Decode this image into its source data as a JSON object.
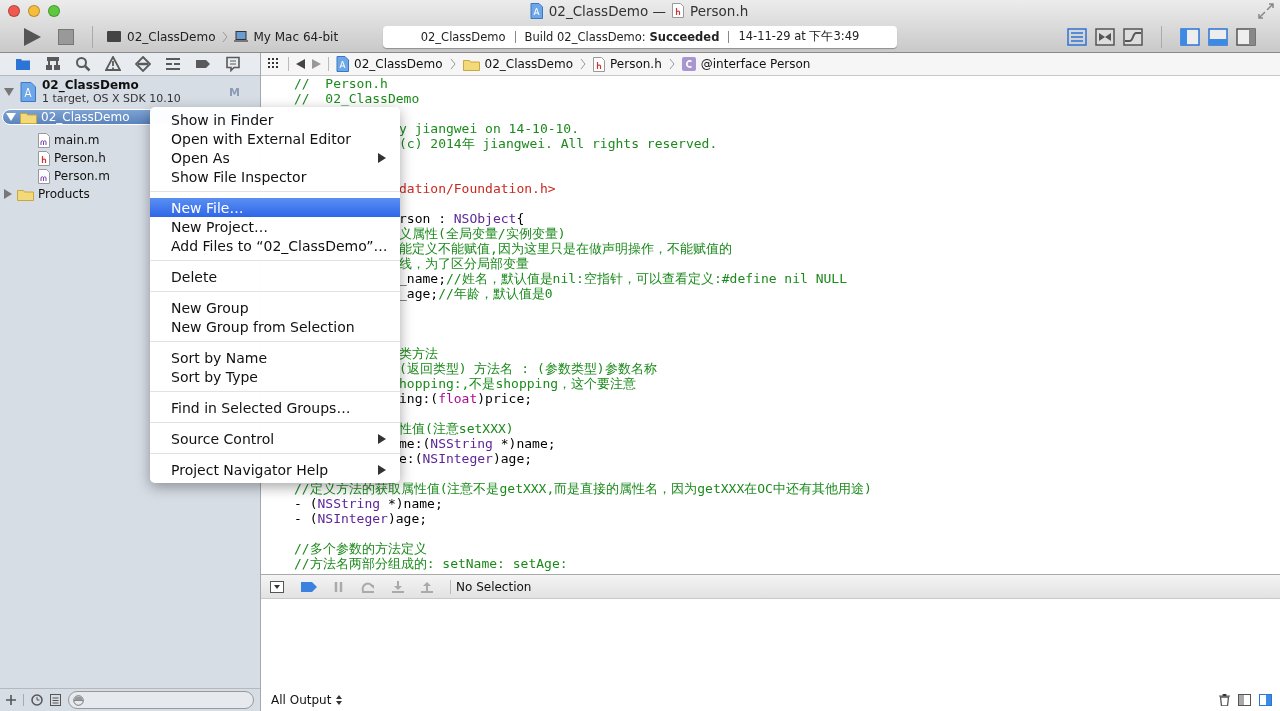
{
  "window": {
    "title_project": "02_ClassDemo —",
    "title_file": "Person.h"
  },
  "toolbar": {
    "scheme": "02_ClassDemo",
    "destination": "My Mac 64-bit",
    "activity": {
      "project": "02_ClassDemo",
      "status": "Build 02_ClassDemo: **Succeeded**",
      "time": "14-11-29 at 下午3:49"
    },
    "editor_modes": [
      {
        "kind": "standard",
        "selected": true
      },
      {
        "kind": "assistant",
        "selected": false
      },
      {
        "kind": "version",
        "selected": false
      }
    ],
    "views": [
      {
        "kind": "navigator",
        "selected": true
      },
      {
        "kind": "debug",
        "selected": true
      },
      {
        "kind": "utilities",
        "selected": false
      }
    ]
  },
  "navigator_tabs": [
    {
      "kind": "project",
      "selected": true
    },
    {
      "kind": "symbol",
      "selected": false
    },
    {
      "kind": "find",
      "selected": false
    },
    {
      "kind": "issue",
      "selected": false
    },
    {
      "kind": "test",
      "selected": false
    },
    {
      "kind": "debug",
      "selected": false
    },
    {
      "kind": "breakpoint",
      "selected": false
    },
    {
      "kind": "log",
      "selected": false
    }
  ],
  "tree": [
    {
      "kind": "project",
      "name": "02_ClassDemo",
      "subtitle": "1 target, OS X SDK 10.10",
      "badge": "M",
      "expanded": true,
      "selected": false,
      "children": [
        {
          "kind": "group",
          "name": "02_ClassDemo",
          "expanded": true,
          "selected": true,
          "children": [
            {
              "kind": "m",
              "name": "main.m",
              "selected": false
            },
            {
              "kind": "h",
              "name": "Person.h",
              "selected": false
            },
            {
              "kind": "m",
              "name": "Person.m",
              "selected": false
            }
          ]
        },
        {
          "kind": "group",
          "name": "Products",
          "expanded": false,
          "selected": false
        }
      ]
    }
  ],
  "jump_bar": [
    {
      "kind": "project",
      "label": "02_ClassDemo"
    },
    {
      "kind": "group",
      "label": "02_ClassDemo"
    },
    {
      "kind": "h",
      "label": "Person.h"
    },
    {
      "kind": "class",
      "label": "@interface Person"
    }
  ],
  "code": [
    {
      "kind": "code",
      "spans": [
        {
          "kind": "comment",
          "text": "//  Person.h"
        }
      ]
    },
    {
      "kind": "code",
      "spans": [
        {
          "kind": "comment",
          "text": "//  02_ClassDemo"
        }
      ]
    },
    {
      "kind": "blank"
    },
    {
      "kind": "tail",
      "spans": [
        {
          "kind": "comment",
          "text": "y jiangwei on 14-10-10."
        }
      ]
    },
    {
      "kind": "tail",
      "spans": [
        {
          "kind": "comment",
          "text": "(c) 2014年 jiangwei. All rights reserved."
        }
      ]
    },
    {
      "kind": "blank"
    },
    {
      "kind": "blank"
    },
    {
      "kind": "tail",
      "spans": [
        {
          "kind": "preproc",
          "text": "dation/Foundation.h>"
        }
      ]
    },
    {
      "kind": "blank"
    },
    {
      "kind": "tail",
      "spans": [
        {
          "kind": "plain",
          "text": "rson : "
        },
        {
          "kind": "type",
          "text": "NSObject"
        },
        {
          "kind": "plain",
          "text": "{"
        }
      ]
    },
    {
      "kind": "tail",
      "spans": [
        {
          "kind": "comment",
          "text": "义属性(全局变量/实例变量)"
        }
      ]
    },
    {
      "kind": "tail",
      "spans": [
        {
          "kind": "comment",
          "text": "能定义不能赋值,因为这里只是在做声明操作，不能赋值的"
        }
      ]
    },
    {
      "kind": "tail",
      "spans": [
        {
          "kind": "comment",
          "text": "线，为了区分局部变量"
        }
      ]
    },
    {
      "kind": "tail",
      "spans": [
        {
          "kind": "plain",
          "text": "_name;"
        },
        {
          "kind": "comment",
          "text": "//姓名，默认值是nil:空指针，可以查看定义:#define nil NULL"
        }
      ]
    },
    {
      "kind": "tail",
      "spans": [
        {
          "kind": "plain",
          "text": "_age;"
        },
        {
          "kind": "comment",
          "text": "//年龄，默认值是0"
        }
      ]
    },
    {
      "kind": "blank"
    },
    {
      "kind": "blank"
    },
    {
      "kind": "blank"
    },
    {
      "kind": "tail",
      "spans": [
        {
          "kind": "comment",
          "text": "类方法"
        }
      ]
    },
    {
      "kind": "tail",
      "spans": [
        {
          "kind": "comment",
          "text": "(返回类型) 方法名 : (参数类型)参数名称"
        }
      ]
    },
    {
      "kind": "tail",
      "spans": [
        {
          "kind": "comment",
          "text": "hopping:,不是shopping，这个要注意"
        }
      ]
    },
    {
      "kind": "tail",
      "spans": [
        {
          "kind": "plain",
          "text": "ing:("
        },
        {
          "kind": "keyword",
          "text": "float"
        },
        {
          "kind": "plain",
          "text": ")price;"
        }
      ]
    },
    {
      "kind": "blank"
    },
    {
      "kind": "tail",
      "spans": [
        {
          "kind": "comment",
          "text": "性值(注意setXXX)"
        }
      ]
    },
    {
      "kind": "tail",
      "spans": [
        {
          "kind": "plain",
          "text": "me:("
        },
        {
          "kind": "type",
          "text": "NSString"
        },
        {
          "kind": "plain",
          "text": " *)name;"
        }
      ]
    },
    {
      "kind": "tail",
      "spans": [
        {
          "kind": "plain",
          "text": "e:("
        },
        {
          "kind": "type",
          "text": "NSInteger"
        },
        {
          "kind": "plain",
          "text": ")age;"
        }
      ]
    },
    {
      "kind": "blank"
    },
    {
      "kind": "code",
      "spans": [
        {
          "kind": "comment",
          "text": "//定义方法的获取属性值(注意不是getXXX,而是直接的属性名，因为getXXX在OC中还有其他用途)"
        }
      ]
    },
    {
      "kind": "code",
      "spans": [
        {
          "kind": "plain",
          "text": "- ("
        },
        {
          "kind": "type",
          "text": "NSString"
        },
        {
          "kind": "plain",
          "text": " *)name;"
        }
      ]
    },
    {
      "kind": "code",
      "spans": [
        {
          "kind": "plain",
          "text": "- ("
        },
        {
          "kind": "type",
          "text": "NSInteger"
        },
        {
          "kind": "plain",
          "text": ")age;"
        }
      ]
    },
    {
      "kind": "blank"
    },
    {
      "kind": "code",
      "spans": [
        {
          "kind": "comment",
          "text": "//多个参数的方法定义"
        }
      ]
    },
    {
      "kind": "code",
      "spans": [
        {
          "kind": "comment",
          "text": "//方法名两部分组成的: setName: setAge:"
        }
      ]
    }
  ],
  "debug_bar": {
    "breakpoints_on": true,
    "status": "No Selection"
  },
  "console": {
    "filter": "All Output",
    "panes": [
      {
        "kind": "variables",
        "selected": false
      },
      {
        "kind": "console",
        "selected": true
      }
    ]
  },
  "context_menu": [
    {
      "kind": "item",
      "label": "Show in Finder",
      "selected": false,
      "submenu": false
    },
    {
      "kind": "item",
      "label": "Open with External Editor",
      "selected": false,
      "submenu": false
    },
    {
      "kind": "item",
      "label": "Open As",
      "selected": false,
      "submenu": true
    },
    {
      "kind": "item",
      "label": "Show File Inspector",
      "selected": false,
      "submenu": false
    },
    {
      "kind": "separator"
    },
    {
      "kind": "item",
      "label": "New File…",
      "selected": true,
      "submenu": false
    },
    {
      "kind": "item",
      "label": "New Project…",
      "selected": false,
      "submenu": false
    },
    {
      "kind": "item",
      "label": "Add Files to “02_ClassDemo”…",
      "selected": false,
      "submenu": false
    },
    {
      "kind": "separator"
    },
    {
      "kind": "item",
      "label": "Delete",
      "selected": false,
      "submenu": false
    },
    {
      "kind": "separator"
    },
    {
      "kind": "item",
      "label": "New Group",
      "selected": false,
      "submenu": false
    },
    {
      "kind": "item",
      "label": "New Group from Selection",
      "selected": false,
      "submenu": false
    },
    {
      "kind": "separator"
    },
    {
      "kind": "item",
      "label": "Sort by Name",
      "selected": false,
      "submenu": false
    },
    {
      "kind": "item",
      "label": "Sort by Type",
      "selected": false,
      "submenu": false
    },
    {
      "kind": "separator"
    },
    {
      "kind": "item",
      "label": "Find in Selected Groups…",
      "selected": false,
      "submenu": false
    },
    {
      "kind": "separator"
    },
    {
      "kind": "item",
      "label": "Source Control",
      "selected": false,
      "submenu": true
    },
    {
      "kind": "separator"
    },
    {
      "kind": "item",
      "label": "Project Navigator Help",
      "selected": false,
      "submenu": true
    }
  ]
}
